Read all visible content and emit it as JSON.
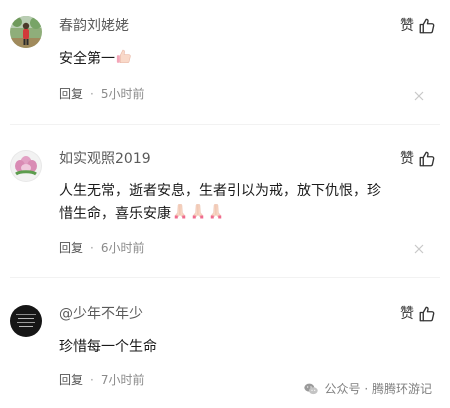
{
  "comments": [
    {
      "username": "春韵刘姥姥",
      "like_label": "赞",
      "text": "安全第一",
      "emoji": [
        "thumbs-up"
      ],
      "reply_label": "回复",
      "separator": "·",
      "time": "5小时前"
    },
    {
      "username": "如实观照2019",
      "like_label": "赞",
      "text_line1": "人生无常，逝者安息，生者引以为戒，放下仇恨，珍",
      "text_line2": "惜生命，喜乐安康",
      "emoji": [
        "praying-hands",
        "praying-hands",
        "praying-hands"
      ],
      "reply_label": "回复",
      "separator": "·",
      "time": "6小时前"
    },
    {
      "username": "@少年不年少",
      "like_label": "赞",
      "text": "珍惜每一个生命",
      "reply_label": "回复",
      "separator": "·",
      "time": "7小时前"
    }
  ],
  "watermark": {
    "label": "公众号 · 腾腾环游记",
    "icon": "wechat-icon"
  },
  "colors": {
    "username": "#5a5a5a",
    "body_text": "#1a1a1a",
    "meta": "#7a7a7a"
  }
}
